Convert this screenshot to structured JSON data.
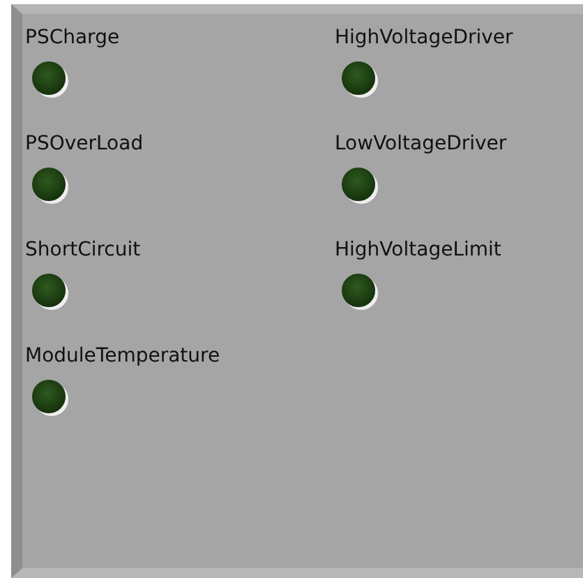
{
  "columns": [
    {
      "indicators": [
        {
          "label": "PSCharge",
          "on": false
        },
        {
          "label": "PSOverLoad",
          "on": false
        },
        {
          "label": "ShortCircuit",
          "on": false
        },
        {
          "label": "ModuleTemperature",
          "on": false
        }
      ]
    },
    {
      "indicators": [
        {
          "label": "HighVoltageDriver",
          "on": false
        },
        {
          "label": "LowVoltageDriver",
          "on": false
        },
        {
          "label": "HighVoltageLimit",
          "on": false
        }
      ]
    }
  ]
}
